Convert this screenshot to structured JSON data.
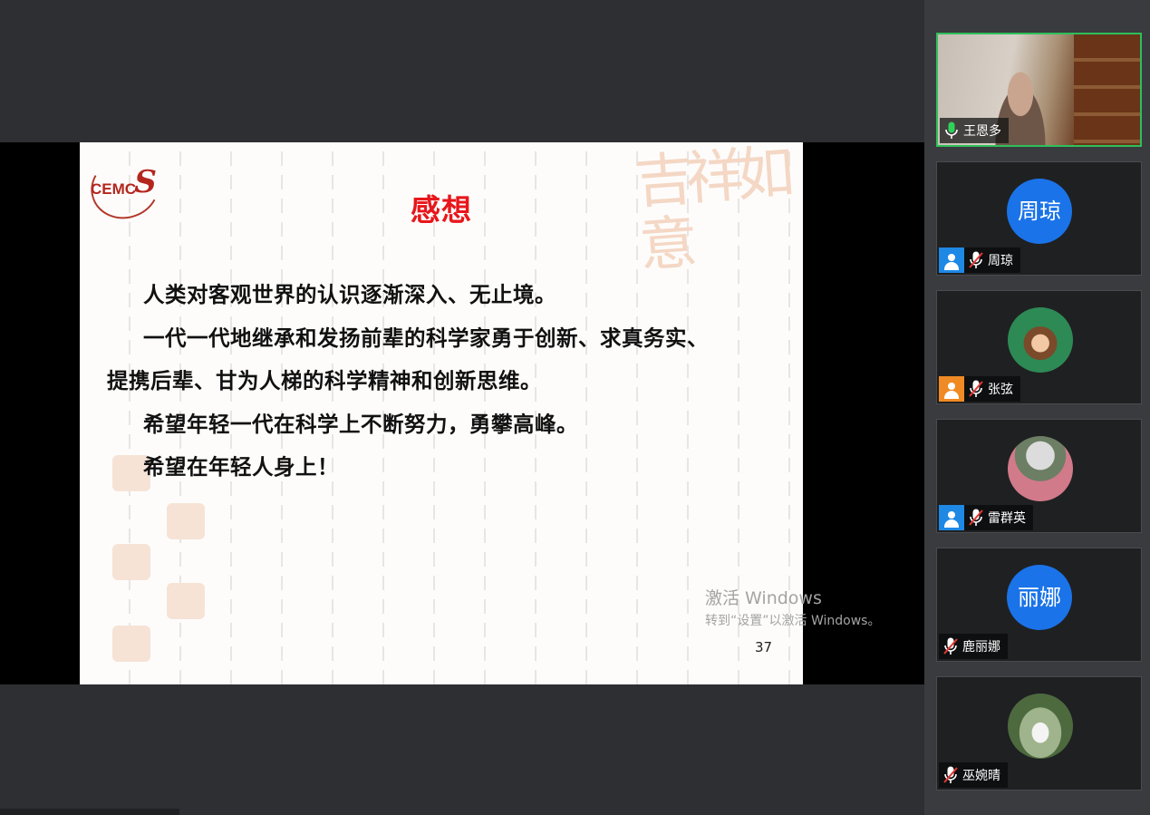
{
  "slide": {
    "logo_text": "CEMC",
    "title": "感想",
    "lines": [
      "人类对客观世界的认识逐渐深入、无止境。",
      "一代一代地继承和发扬前辈的科学家勇于创新、求真务实、",
      "提携后辈、甘为人梯的科学精神和创新思维。",
      "希望年轻一代在科学上不断努力，勇攀高峰。",
      "希望在年轻人身上！"
    ],
    "page_number": "37",
    "deco_text": "吉祥如意"
  },
  "os_watermark": {
    "line1": "激活 Windows",
    "line2": "转到“设置”以激活 Windows。"
  },
  "participants": [
    {
      "name": "王恩多",
      "mic": "on",
      "video": true
    },
    {
      "name": "周琼",
      "avatar_text": "周琼",
      "mic": "muted",
      "badge": "blue"
    },
    {
      "name": "张弦",
      "mic": "muted",
      "badge": "orange",
      "photo": "summer"
    },
    {
      "name": "雷群英",
      "mic": "muted",
      "badge": "blue",
      "photo": "flowers"
    },
    {
      "name": "鹿丽娜",
      "avatar_text": "丽娜",
      "mic": "muted"
    },
    {
      "name": "巫婉晴",
      "mic": "muted",
      "photo": "outdoor"
    }
  ],
  "colors": {
    "title_red": "#e8161b",
    "active_border": "#2fbf5a",
    "avatar_blue": "#1a73e8"
  }
}
